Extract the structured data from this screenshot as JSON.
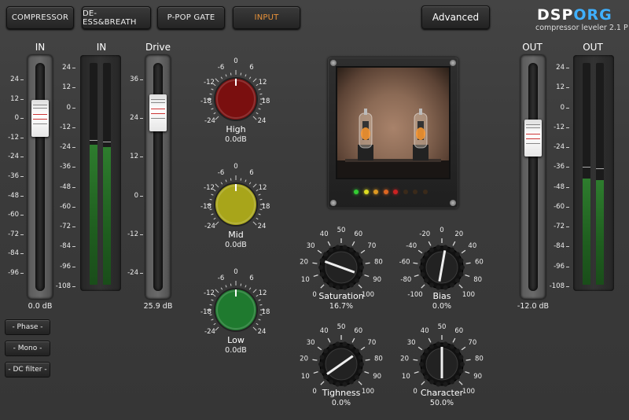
{
  "tabs": [
    {
      "label": "COMPRESSOR",
      "active": false
    },
    {
      "label": "DE-ESS&BREATH",
      "active": false
    },
    {
      "label": "P-POP GATE",
      "active": false
    },
    {
      "label": "INPUT",
      "active": true
    }
  ],
  "advanced_label": "Advanced",
  "logo": {
    "part1": "DSP",
    "part2": "ORG",
    "subtitle": "compressor leveler 2.1 P"
  },
  "in_fader": {
    "title": "IN",
    "scale": [
      "24",
      "12",
      "0",
      "-12",
      "-24",
      "-36",
      "-48",
      "-60",
      "-72",
      "-84",
      "-96"
    ],
    "value": "0.0 dB"
  },
  "in_meter": {
    "title": "IN",
    "scale": [
      "24",
      "12",
      "0",
      "-12",
      "-24",
      "-36",
      "-48",
      "-60",
      "-72",
      "-84",
      "-96",
      "-108"
    ],
    "level_left": 0.63,
    "level_right": 0.62
  },
  "drive": {
    "title": "Drive",
    "scale": [
      "36",
      "24",
      "12",
      "0",
      "-12",
      "-24"
    ],
    "value": "25.9 dB"
  },
  "eq_scale": [
    "-6",
    "0",
    "6",
    "-12",
    "12",
    "-18",
    "18",
    "-24",
    "24"
  ],
  "eq": [
    {
      "label": "High",
      "value": "0.0dB",
      "color": "#7a0f0f"
    },
    {
      "label": "Mid",
      "value": "0.0dB",
      "color": "#a8a51a"
    },
    {
      "label": "Low",
      "value": "0.0dB",
      "color": "#1f7a2f"
    }
  ],
  "knobs": [
    {
      "label": "Saturation",
      "value": "16.7%",
      "ticks": [
        "0",
        "10",
        "20",
        "30",
        "40",
        "50",
        "60",
        "70",
        "80",
        "90",
        "100"
      ],
      "angle": -70
    },
    {
      "label": "Bias",
      "value": "0.0%",
      "ticks": [
        "-100",
        "-80",
        "-60",
        "-40",
        "-20",
        "0",
        "20",
        "40",
        "60",
        "80",
        "100"
      ],
      "angle": 10
    },
    {
      "label": "Tighness",
      "value": "0.0%",
      "ticks": [
        "0",
        "10",
        "20",
        "30",
        "40",
        "50",
        "60",
        "70",
        "80",
        "90",
        "100"
      ],
      "angle": -125
    },
    {
      "label": "Character",
      "value": "50.0%",
      "ticks": [
        "0",
        "10",
        "20",
        "30",
        "40",
        "50",
        "60",
        "70",
        "80",
        "90",
        "100"
      ],
      "angle": 0
    }
  ],
  "leds": [
    "#33cc33",
    "#dddd22",
    "#dd9922",
    "#dd6622",
    "#cc2222",
    "#3a2a1a",
    "#3a2a1a",
    "#3a2a1a"
  ],
  "out_fader": {
    "title": "OUT",
    "value": "-12.0 dB"
  },
  "out_meter": {
    "title": "OUT",
    "scale": [
      "24",
      "12",
      "0",
      "-12",
      "-24",
      "-36",
      "-48",
      "-60",
      "-72",
      "-84",
      "-96",
      "-108"
    ],
    "level_left": 0.48,
    "level_right": 0.47
  },
  "side_buttons": [
    "- Phase -",
    "- Mono -",
    "- DC filter -"
  ]
}
